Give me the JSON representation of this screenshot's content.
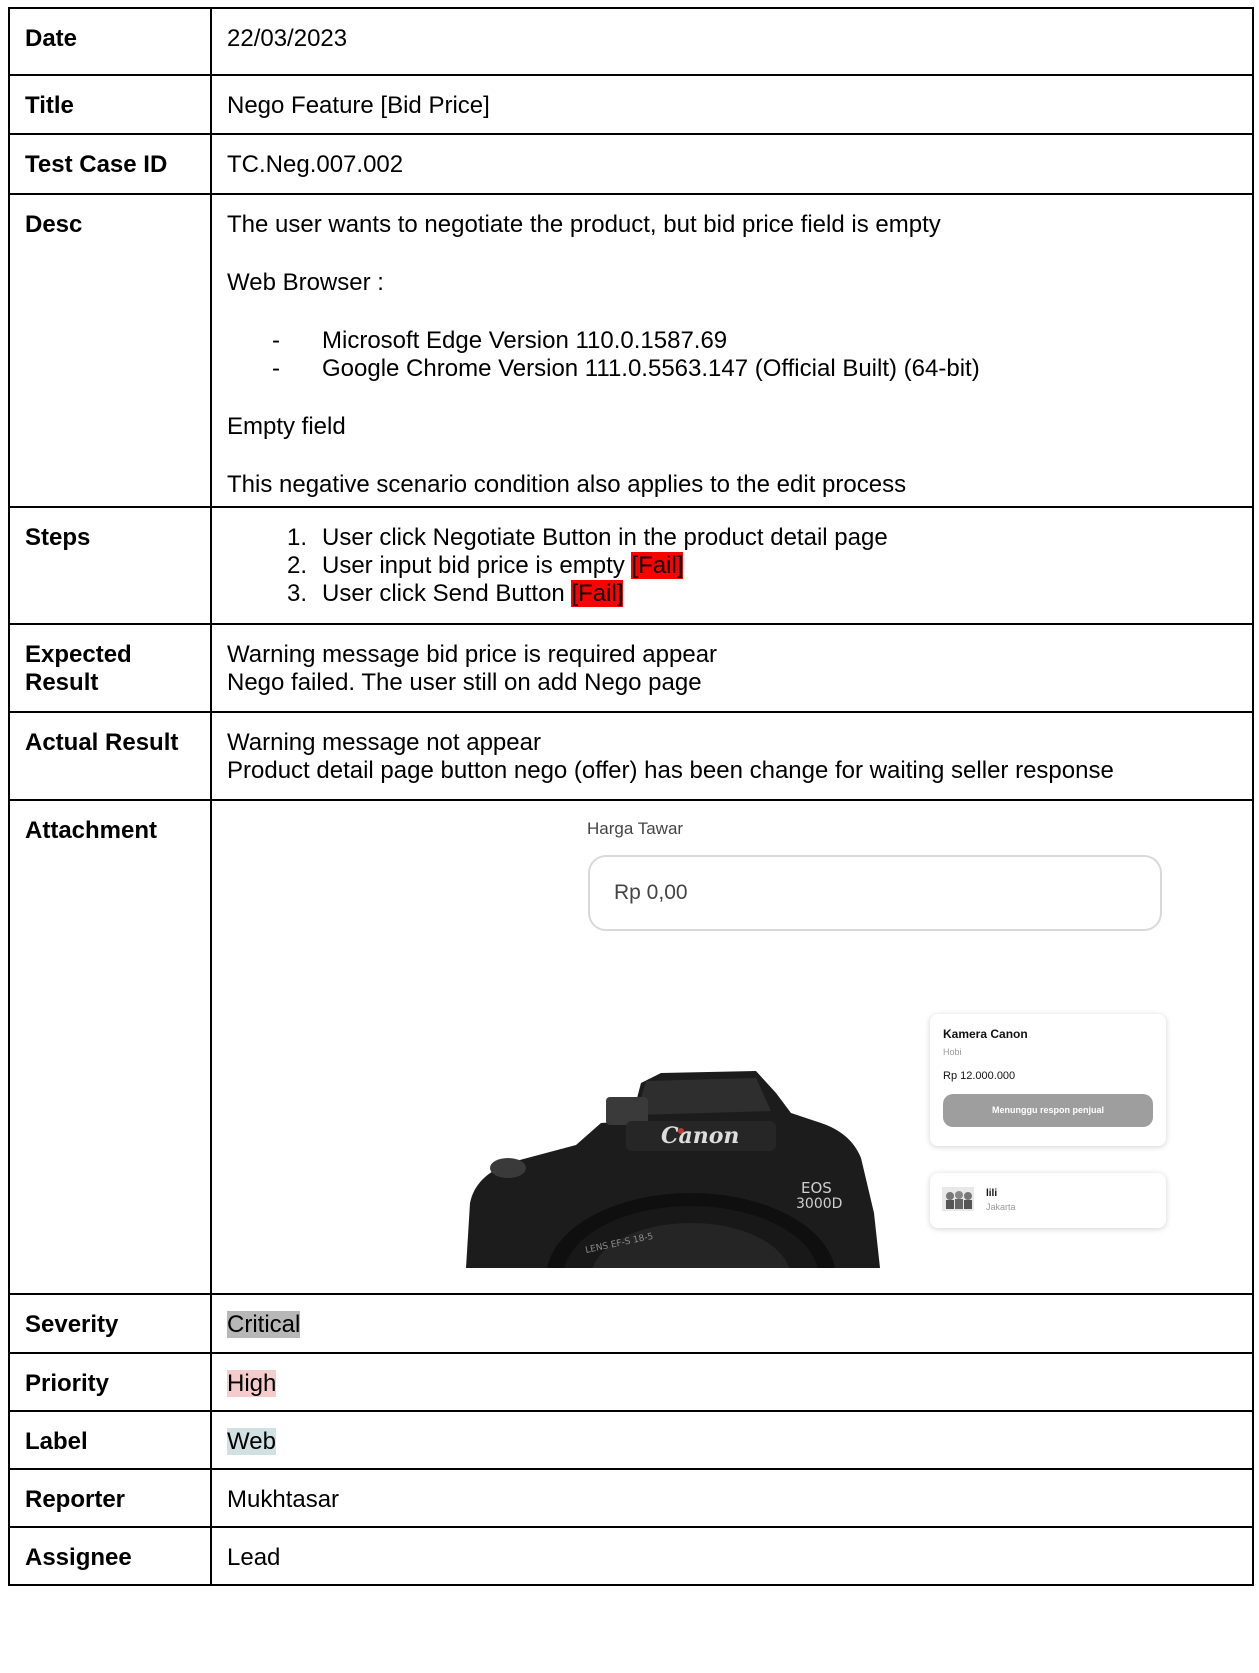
{
  "rows": {
    "date": {
      "label": "Date",
      "value": "22/03/2023"
    },
    "title": {
      "label": "Title",
      "value": "Nego Feature [Bid Price]"
    },
    "test_case_id": {
      "label": "Test Case ID",
      "value": "TC.Neg.007.002"
    },
    "desc": {
      "label": "Desc",
      "intro": "The user wants to negotiate the product, but bid price field is empty",
      "browser_heading": "Web Browser :",
      "browsers": [
        "Microsoft Edge Version 110.0.1587.69",
        "Google Chrome Version 111.0.5563.147 (Official Built) (64-bit)"
      ],
      "bullet_marker": "-",
      "field_state": "Empty field",
      "note": "This negative scenario condition also applies to the edit process"
    },
    "steps": {
      "label": "Steps",
      "items": [
        {
          "num": "1.",
          "text": "User click Negotiate Button in the product detail page",
          "tag": ""
        },
        {
          "num": "2.",
          "text": "User input bid price is empty ",
          "tag": "[Fail]"
        },
        {
          "num": "3.",
          "text": "User click Send Button ",
          "tag": "[Fail]"
        }
      ]
    },
    "expected": {
      "label": "Expected Result",
      "lines": [
        "Warning message bid price is required appear",
        "Nego failed. The user still on add Nego page"
      ]
    },
    "actual": {
      "label": "Actual Result",
      "lines": [
        "Warning message not appear",
        "Product detail page button nego (offer) has been change for waiting seller response"
      ]
    },
    "attachment": {
      "label": "Attachment",
      "bid_label": "Harga Tawar",
      "bid_value": "Rp 0,00",
      "product_name": "Kamera Canon",
      "product_category": "Hobi",
      "product_price": "Rp 12.000.000",
      "status_button": "Menunggu respon penjual",
      "seller_name": "lili",
      "seller_city": "Jakarta",
      "camera_brand": "Canon",
      "camera_model_line1": "EOS",
      "camera_model_line2": "3000D",
      "lens_text": "LENS EF-S 18-5"
    },
    "severity": {
      "label": "Severity",
      "value": "Critical"
    },
    "priority": {
      "label": "Priority",
      "value": "High"
    },
    "label": {
      "label": "Label",
      "value": "Web"
    },
    "reporter": {
      "label": "Reporter",
      "value": "Mukhtasar"
    },
    "assignee": {
      "label": "Assignee",
      "value": "Lead"
    }
  },
  "colors": {
    "severity_highlight": "#b7b7b7",
    "priority_highlight": "#f4cccc",
    "label_highlight": "#d0e0e3",
    "fail_highlight": "#ff0000"
  }
}
